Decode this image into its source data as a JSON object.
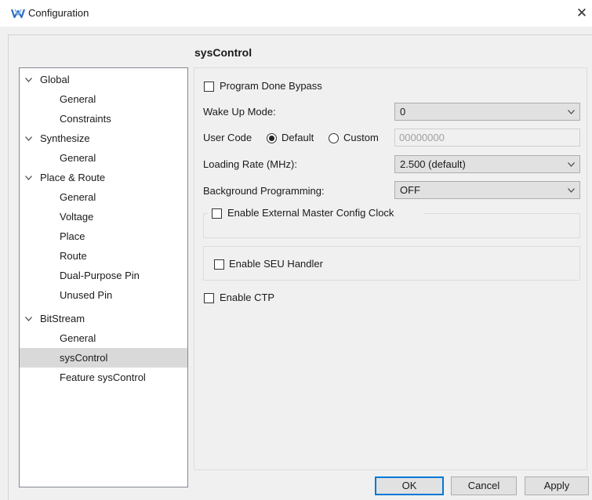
{
  "window": {
    "title": "Configuration",
    "icon": "gowin-logo-icon",
    "close_glyph": "✕"
  },
  "header": {
    "title": "sysControl"
  },
  "tree": [
    {
      "label": "Global",
      "level": 0,
      "expanded": true
    },
    {
      "label": "General",
      "level": 1
    },
    {
      "label": "Constraints",
      "level": 1
    },
    {
      "label": "Synthesize",
      "level": 0,
      "expanded": true
    },
    {
      "label": "General",
      "level": 1
    },
    {
      "label": "Place & Route",
      "level": 0,
      "expanded": true
    },
    {
      "label": "General",
      "level": 1
    },
    {
      "label": "Voltage",
      "level": 1
    },
    {
      "label": "Place",
      "level": 1
    },
    {
      "label": "Route",
      "level": 1
    },
    {
      "label": "Dual-Purpose Pin",
      "level": 1
    },
    {
      "label": "Unused Pin",
      "level": 1
    },
    {
      "label": "BitStream",
      "level": 0,
      "expanded": true
    },
    {
      "label": "General",
      "level": 1
    },
    {
      "label": "sysControl",
      "level": 1,
      "selected": true
    },
    {
      "label": "Feature sysControl",
      "level": 1
    }
  ],
  "form": {
    "program_done_bypass": {
      "label": "Program Done Bypass",
      "checked": false
    },
    "wake_up_mode": {
      "label": "Wake Up Mode:",
      "value": "0"
    },
    "user_code": {
      "label": "User Code",
      "default_label": "Default",
      "custom_label": "Custom",
      "selected": "Default",
      "value": "00000000"
    },
    "loading_rate": {
      "label": "Loading Rate (MHz):",
      "value": "2.500 (default)"
    },
    "background_programming": {
      "label": "Background Programming:",
      "value": "OFF"
    },
    "external_master_clock": {
      "label": "Enable External Master Config Clock",
      "checked": false
    },
    "seu_handler": {
      "label": "Enable SEU Handler",
      "checked": false
    },
    "enable_ctp": {
      "label": "Enable CTP",
      "checked": false
    }
  },
  "buttons": {
    "ok": "OK",
    "cancel": "Cancel",
    "apply": "Apply"
  },
  "colors": {
    "selection": "#d9d9d9",
    "default_button_border": "#0078d7",
    "logo": "#2f6fc4"
  }
}
